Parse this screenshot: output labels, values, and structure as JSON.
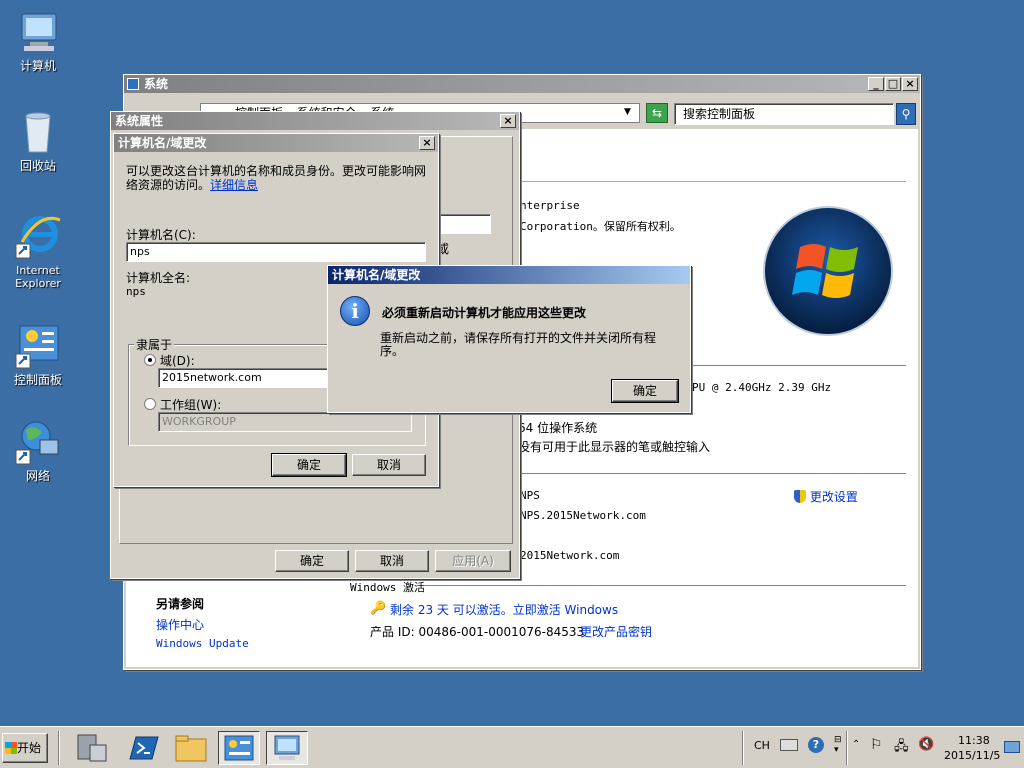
{
  "desktop": {
    "icons": [
      {
        "label": "计算机",
        "icon": "computer-icon"
      },
      {
        "label": "回收站",
        "icon": "recycle-bin-icon"
      },
      {
        "label": "Internet Explorer",
        "icon": "internet-explorer-icon"
      },
      {
        "label": "控制面板",
        "icon": "control-panel-icon"
      },
      {
        "label": "网络",
        "icon": "network-icon"
      }
    ]
  },
  "system_window": {
    "title": "系统",
    "address": "控制面板 ▸ 系统和安全 ▸ 系统",
    "search_placeholder": "搜索控制面板",
    "edition_text": "nterprise",
    "copyright_text": " Corporation。保留所有权利。",
    "processor_text": "PU @ 2.40GHz   2.39 GHz",
    "system_type": "64 位操作系统",
    "pen_touch": "没有可用于此显示器的笔或触控输入",
    "computer_name": "NPS",
    "full_name": "NPS.2015Network.com",
    "domain": "2015Network.com",
    "change_settings": "更改设置",
    "activation_header": "Windows 激活",
    "activation_text": "剩余 23 天 可以激活。立即激活 Windows",
    "product_id": "产品 ID: 00486-001-0001076-84533",
    "change_key": "更改产品密钥",
    "see_also": "另请参阅",
    "see_also_links": [
      "操作中心",
      "Windows Update"
    ]
  },
  "sysprops_dialog": {
    "title": "系统属性",
    "ok": "确定",
    "cancel": "取消",
    "apply": "应用(A)",
    "behind_text": "或"
  },
  "rename_dialog": {
    "title": "计算机名/域更改",
    "description": "可以更改这台计算机的名称和成员身份。更改可能影响网络资源的访问。",
    "more_info": "详细信息",
    "name_label": "计算机名(C):",
    "name_value": "nps",
    "fullname_label": "计算机全名:",
    "fullname_value": "nps",
    "member_of": "隶属于",
    "domain_label": "域(D):",
    "domain_value": "2015network.com",
    "workgroup_label": "工作组(W):",
    "workgroup_value": "WORKGROUP",
    "ok": "确定",
    "cancel": "取消"
  },
  "message_box": {
    "title": "计算机名/域更改",
    "heading": "必须重新启动计算机才能应用这些更改",
    "body": "重新启动之前，请保存所有打开的文件并关闭所有程序。",
    "ok": "确定"
  },
  "taskbar": {
    "start": "开始",
    "lang": "CH",
    "time": "11:38",
    "date": "2015/11/5"
  }
}
